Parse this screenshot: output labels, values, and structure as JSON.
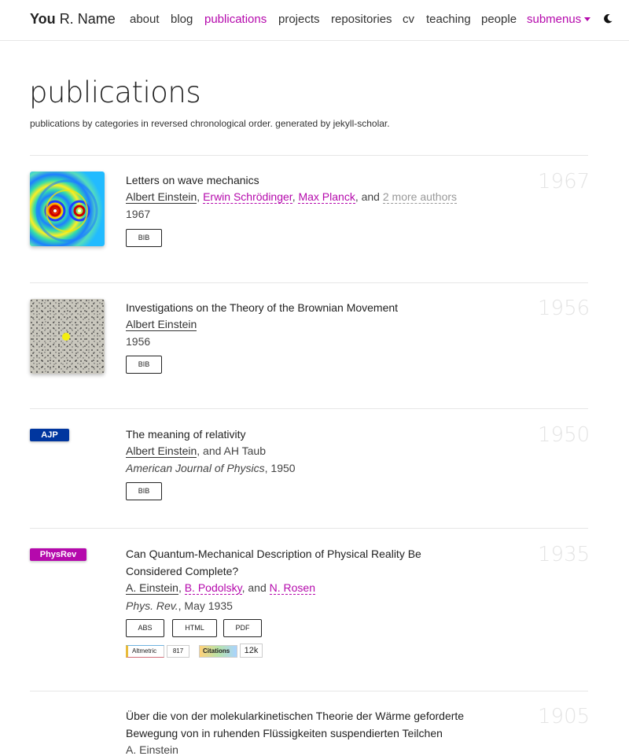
{
  "brand": {
    "first": "You",
    "rest": "R. Name"
  },
  "nav": [
    "about",
    "blog",
    "publications",
    "projects",
    "repositories",
    "cv",
    "teaching",
    "people"
  ],
  "nav_submenu": "submenus",
  "page": {
    "title": "publications",
    "description": "publications by categories in reversed chronological order. generated by jekyll-scholar."
  },
  "entries": [
    {
      "title": "Letters on wave mechanics",
      "authors": [
        "Albert Einstein",
        "Erwin Schrödinger",
        "Max Planck"
      ],
      "and": ", and",
      "more": "2 more authors",
      "venue": "1967",
      "year": "1967",
      "buttons": [
        "BIB"
      ]
    },
    {
      "title": "Investigations on the Theory of the Brownian Movement",
      "authors": [
        "Albert Einstein"
      ],
      "venue": "1956",
      "year": "1956",
      "buttons": [
        "BIB"
      ]
    },
    {
      "abbr": "AJP",
      "abbr_color": "#00369f",
      "title": "The meaning of relativity",
      "authors": [
        "Albert Einstein",
        "AH Taub"
      ],
      "and": ", and",
      "venue_journal": "American Journal of Physics",
      "venue_rest": ", 1950",
      "year": "1950",
      "buttons": [
        "BIB"
      ]
    },
    {
      "abbr": "PhysRev",
      "abbr_color": "#b509ac",
      "title": "Can Quantum-Mechanical Description of Physical Reality Be Considered Complete?",
      "authors": [
        "A. Einstein",
        "B. Podolsky",
        "N. Rosen"
      ],
      "and": ", and",
      "venue_journal": "Phys. Rev.",
      "venue_rest": ", May 1935",
      "year": "1935",
      "buttons": [
        "ABS",
        "HTML",
        "PDF"
      ],
      "badges": {
        "altmetric_label": "Altmetric",
        "altmetric_value": "817",
        "citations_label": "Citations",
        "citations_value": "12k"
      }
    },
    {
      "title": "Über die von der molekularkinetischen Theorie der Wärme geforderte Bewegung von in ruhenden Flüssigkeiten suspendierten Teilchen",
      "authors": [
        "A. Einstein"
      ],
      "year": "1905"
    }
  ],
  "colors": {
    "accent": "#b509ac",
    "ajp": "#00369f"
  }
}
